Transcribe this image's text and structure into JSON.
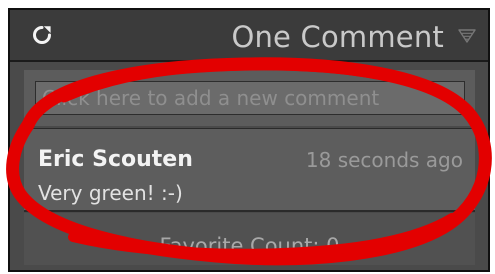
{
  "header": {
    "title": "One Comment",
    "refresh_icon": "refresh-icon",
    "collapse_icon": "collapse-triangle-icon"
  },
  "comment_input": {
    "placeholder": "Click here to add a new comment"
  },
  "comments": [
    {
      "author": "Eric Scouten",
      "time": "18 seconds ago",
      "text": "Very green! :-)"
    }
  ],
  "favorite": {
    "label": "Favorite Count: 0"
  },
  "colors": {
    "annotation_red": "#e30000",
    "panel_dark": "#3b3b3b",
    "panel_mid": "#5d5d5d"
  }
}
